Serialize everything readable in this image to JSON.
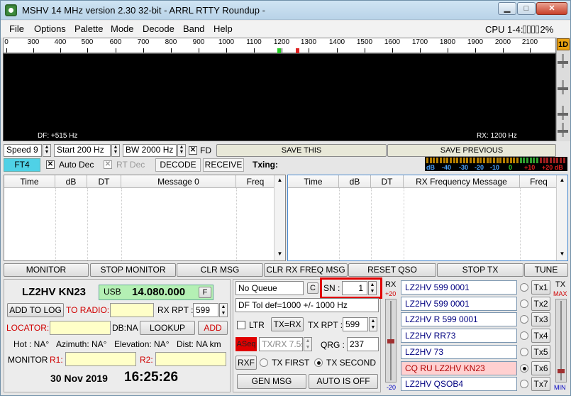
{
  "window": {
    "title": "MSHV 14 MHz version 2.30 32-bit  - ARRL RTTY Roundup -",
    "minimize": "▁",
    "maximize": "□",
    "close": "✕"
  },
  "menu": {
    "items": [
      "File",
      "Options",
      "Palette",
      "Mode",
      "Decode",
      "Band",
      "Help"
    ],
    "cpu_label": "CPU 1-4:",
    "cpu_value": "2%"
  },
  "ruler": {
    "labels": [
      "0",
      "300",
      "400",
      "500",
      "600",
      "700",
      "800",
      "900",
      "1000",
      "1100",
      "1200",
      "1300",
      "1400",
      "1500",
      "1600",
      "1700",
      "1800",
      "1900",
      "2000",
      "2100"
    ]
  },
  "waterfall": {
    "df": "DF: +515 Hz",
    "rx": "RX: 1200 Hz",
    "mode_button": "1D"
  },
  "controls": {
    "speed": "Speed 9",
    "start": "Start 200 Hz",
    "bw": "BW 2000 Hz",
    "fd": "FD",
    "save_this": "SAVE THIS",
    "save_previous": "SAVE PREVIOUS"
  },
  "mode": {
    "ft4": "FT4",
    "auto_dec": "Auto Dec",
    "rt_dec": "RT Dec",
    "decode": "DECODE",
    "receive": "RECEIVE",
    "txing": "Txing:"
  },
  "meter": {
    "labels": [
      "dB",
      "-40",
      "-30",
      "-20",
      "-10",
      "0",
      "+10",
      "+20 dB"
    ]
  },
  "left_table": {
    "headers": [
      "Time",
      "dB",
      "DT",
      "Message 0",
      "Freq"
    ]
  },
  "right_table": {
    "headers": [
      "Time",
      "dB",
      "DT",
      "RX Frequency Message",
      "Freq"
    ]
  },
  "action_buttons": [
    "MONITOR",
    "STOP MONITOR",
    "CLR MSG",
    "CLR RX FREQ MSG",
    "RESET QSO",
    "STOP TX",
    "TUNE"
  ],
  "station": {
    "callsign": "LZ2HV KN23",
    "mode": "USB",
    "frequency": "14.080.000",
    "f_button": "F",
    "add_to_log": "ADD TO LOG",
    "to_radio": "TO RADIO:",
    "rx_rpt_label": "RX RPT :",
    "rx_rpt": "599",
    "locator": "LOCATOR:",
    "db": "DB:NA",
    "lookup": "LOOKUP",
    "add": "ADD",
    "hot": "Hot : NA°",
    "azimuth": "Azimuth: NA°",
    "elevation": "Elevation: NA°",
    "dist": "Dist: NA km",
    "monitor": "MONITOR",
    "r1": "R1:",
    "r2": "R2:",
    "date": "30 Nov 2019",
    "time": "16:25:26"
  },
  "queue": {
    "no_queue": "No Queue",
    "c": "C",
    "sn_label": "SN :",
    "sn_value": "1",
    "df_tol": "DF Tol def=1000 +/-  1000  Hz",
    "ltr": "LTR",
    "tx_rx": "TX=RX",
    "tx_rpt_label": "TX RPT :",
    "tx_rpt": "599",
    "aseq": "ASeq",
    "txrx_time": "TX/RX 7.5s",
    "qrg_label": "QRG :",
    "qrg": "237",
    "rxf": "RXF",
    "tx_first": "TX FIRST",
    "tx_second": "TX SECOND",
    "gen_msg": "GEN MSG",
    "auto_off": "AUTO IS OFF"
  },
  "rx_meter": {
    "label": "RX",
    "top": "+20",
    "bottom": "-20"
  },
  "tx_meter": {
    "label": "TX",
    "top": "MAX",
    "bottom": "MIN"
  },
  "tx_messages": [
    {
      "text": "LZ2HV 599 0001",
      "button": "Tx1",
      "selected": false
    },
    {
      "text": "LZ2HV 599 0001",
      "button": "Tx2",
      "selected": false
    },
    {
      "text": "LZ2HV R 599 0001",
      "button": "Tx3",
      "selected": false
    },
    {
      "text": "LZ2HV RR73",
      "button": "Tx4",
      "selected": false
    },
    {
      "text": "LZ2HV 73",
      "button": "Tx5",
      "selected": false
    },
    {
      "text": "CQ RU LZ2HV KN23",
      "button": "Tx6",
      "selected": true
    },
    {
      "text": "LZ2HV QSOB4",
      "button": "Tx7",
      "selected": false
    }
  ],
  "colors": {
    "ft4": "#4fd1e6",
    "highlight": "#e00000",
    "selected_msg": "#ffd0d0",
    "usb_green": "#b4f0b4"
  }
}
